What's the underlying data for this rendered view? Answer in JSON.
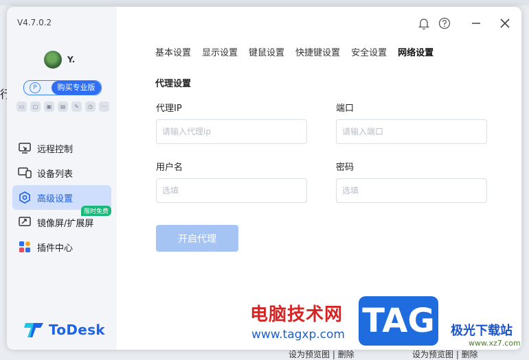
{
  "app": {
    "version": "V4.7.0.2",
    "username": "Y.",
    "buy_button": "购买专业版",
    "logo_text": "ToDesk"
  },
  "sidebar": {
    "mini_icons": [
      "gamepad-icon",
      "monitor-icon",
      "image-icon",
      "chat-icon",
      "pen-icon",
      "clock-icon",
      "more-icon"
    ],
    "items": [
      {
        "label": "远程控制",
        "icon": "remote-control-icon"
      },
      {
        "label": "设备列表",
        "icon": "device-list-icon"
      },
      {
        "label": "高级设置",
        "icon": "advanced-settings-icon",
        "active": true
      },
      {
        "label": "镜像屏/扩展屏",
        "icon": "mirror-screen-icon",
        "badge": "限时免费"
      },
      {
        "label": "插件中心",
        "icon": "plugin-center-icon"
      }
    ]
  },
  "tabs": [
    "基本设置",
    "显示设置",
    "键鼠设置",
    "快捷键设置",
    "安全设置",
    "网络设置"
  ],
  "active_tab": "网络设置",
  "proxy": {
    "section_title": "代理设置",
    "ip_label": "代理IP",
    "ip_placeholder": "请输入代理ip",
    "port_label": "端口",
    "port_placeholder": "请输入端口",
    "user_label": "用户名",
    "user_placeholder": "选填",
    "password_label": "密码",
    "password_placeholder": "选填",
    "enable_button": "开启代理"
  },
  "watermark": {
    "cn_text": "电脑技术网",
    "url": "www.tagxp.com",
    "tag": "TAG",
    "site_name": "极光下载站",
    "site_url": "www.xz7.com"
  },
  "background": {
    "left_glyph": "行",
    "bottom_text_1": "设为预览图 | 删除",
    "bottom_text_2": "设为预览图 | 删除"
  },
  "colors": {
    "accent": "#2f6ef2",
    "active_nav_bg": "#cfdefc",
    "button_disabled": "#a5c4f3",
    "badge_green": "#18b87a"
  }
}
